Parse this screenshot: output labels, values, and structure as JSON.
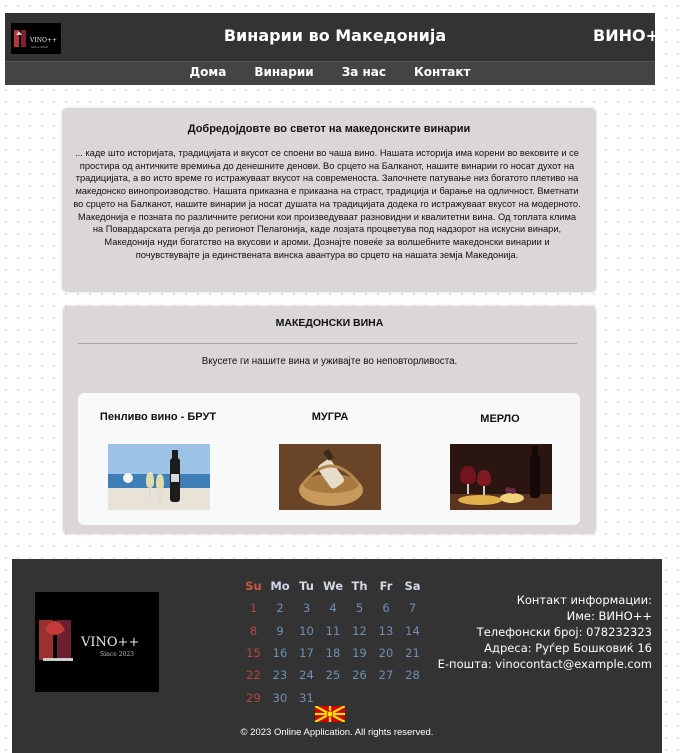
{
  "header": {
    "title": "Винарии во Македонија",
    "brand": "ВИНО++",
    "logo_text": "VINO++",
    "logo_subtext": "Since 2023"
  },
  "nav": {
    "items": [
      {
        "label": "Дома"
      },
      {
        "label": "Винарии"
      },
      {
        "label": "За нас"
      },
      {
        "label": "Контакт"
      }
    ]
  },
  "welcome": {
    "title": "Добредојдовте во светот на македонските винарии",
    "text": "... каде што историјата, традицијата и вкусот се споени во чаша вино. Нашата историја има корени во вековите и се простира од античките времиња до денешните денови. Во срцето на Балканот, нашите винарии го носат духот на традицијата, а во исто време го истражуваат вкусот на современоста. Започнете патување низ богатото плетиво на македонско винопроизводство. Нашата приказна е приказна на страст, традиција и барање на одличност. Вметнати во срцето на Балканот, нашите винарии ја носат душата на традицијата додека го истражуваат вкусот на модерното. Македонија е позната по различните региони кои произведуваат разновидни и квалитетни вина. Од топлата клима на Повардарската регија до регионот Пелагонија, каде лозјата процветува под надзорот на искусни винари, Македонија нуди богатство на вкусови и ароми. Дознајте повеќе за волшебните македонски винарии и почувствувајте ја единствената винска авантура во срцето на нашата земја Македонија."
  },
  "wines": {
    "title": "МАКЕДОНСКИ ВИНА",
    "subtitle": "Вкусете ги нашите вина и уживајте во неповторливоста.",
    "items": [
      {
        "name": "Пенливо вино - БРУТ"
      },
      {
        "name": "МУГРА"
      },
      {
        "name": "МЕРЛО"
      }
    ]
  },
  "footer": {
    "logo_text": "VINO++",
    "logo_subtext": "Since 2023",
    "calendar": {
      "weekdays": [
        "Su",
        "Mo",
        "Tu",
        "We",
        "Th",
        "Fr",
        "Sa"
      ],
      "weeks": [
        [
          "1",
          "2",
          "3",
          "4",
          "5",
          "6",
          "7"
        ],
        [
          "8",
          "9",
          "10",
          "11",
          "12",
          "13",
          "14"
        ],
        [
          "15",
          "16",
          "17",
          "18",
          "19",
          "20",
          "21"
        ],
        [
          "22",
          "23",
          "24",
          "25",
          "26",
          "27",
          "28"
        ],
        [
          "29",
          "30",
          "31",
          "",
          "",
          "",
          ""
        ]
      ]
    },
    "contact": {
      "heading": "Контакт информации:",
      "name": "Име: ВИНО++",
      "phone": "Телефонски број: 078232323",
      "address": "Адреса: Руѓер Бошковиќ 16",
      "email": "Е-пошта: vinocontact@example.com"
    },
    "copyright": "© 2023 Online Application. All rights reserved."
  },
  "colors": {
    "header_bg": "#333333",
    "nav_bg": "#444444",
    "panel_bg": "#dbd7d7",
    "card_bg": "#f7f9fb",
    "calendar_sunday": "#b5473f",
    "calendar_day": "#6f8fb5"
  }
}
